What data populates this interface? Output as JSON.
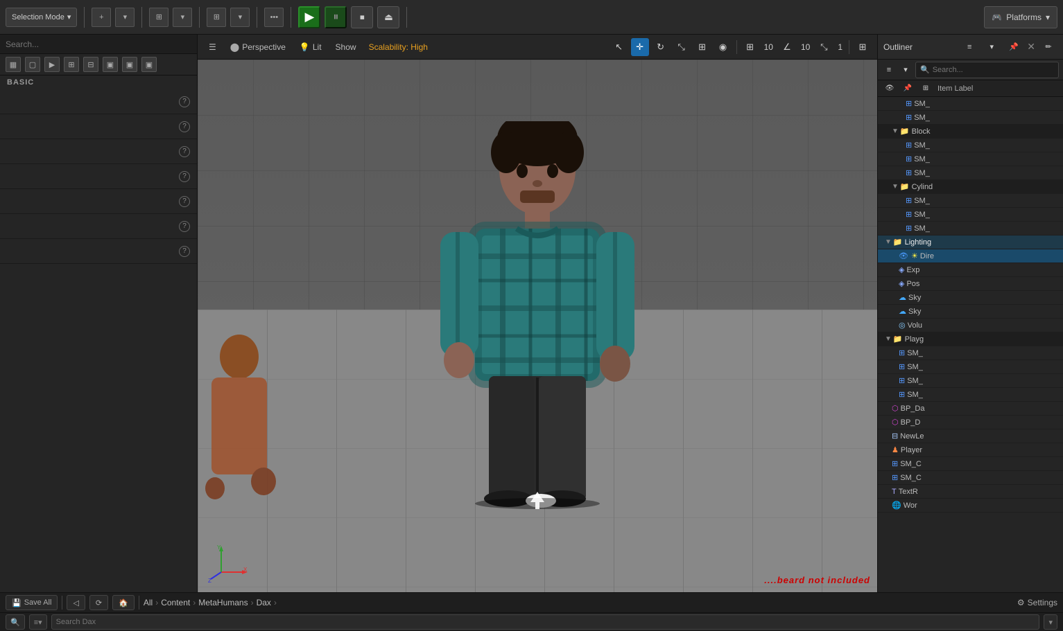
{
  "topToolbar": {
    "modeLabel": "Selection Mode",
    "playLabel": "▶",
    "pauseLabel": "⏸",
    "stopLabel": "⏹",
    "platformsLabel": "Platforms",
    "platformsIcon": "🎮"
  },
  "viewport": {
    "menuIcon": "☰",
    "perspectiveLabel": "Perspective",
    "litLabel": "Lit",
    "showLabel": "Show",
    "scalabilityLabel": "Scalability: High",
    "snapAngle1": "10",
    "snapAngle2": "10",
    "snapScale": "1"
  },
  "leftPanel": {
    "sectionLabel": "BASIC",
    "items": [
      {
        "label": "",
        "id": "item-1"
      },
      {
        "label": "",
        "id": "item-2"
      },
      {
        "label": "",
        "id": "item-3"
      },
      {
        "label": "",
        "id": "item-4"
      },
      {
        "label": "",
        "id": "item-5"
      },
      {
        "label": "",
        "id": "item-6"
      },
      {
        "label": "",
        "id": "item-7"
      }
    ]
  },
  "outliner": {
    "title": "Outliner",
    "searchPlaceholder": "Search...",
    "columnLabel": "Item Label",
    "items": [
      {
        "label": "SM_",
        "indent": 40,
        "type": "mesh",
        "id": "sm1"
      },
      {
        "label": "SM_",
        "indent": 40,
        "type": "mesh",
        "id": "sm2"
      },
      {
        "label": "Block",
        "indent": 20,
        "type": "folder",
        "expanded": true,
        "id": "block-folder"
      },
      {
        "label": "SM_",
        "indent": 40,
        "type": "mesh",
        "id": "sm3"
      },
      {
        "label": "SM_",
        "indent": 40,
        "type": "mesh",
        "id": "sm4"
      },
      {
        "label": "SM_",
        "indent": 40,
        "type": "mesh",
        "id": "sm5"
      },
      {
        "label": "Cylind",
        "indent": 20,
        "type": "folder",
        "expanded": true,
        "id": "cyl-folder"
      },
      {
        "label": "SM_",
        "indent": 40,
        "type": "mesh",
        "id": "sm6"
      },
      {
        "label": "SM_",
        "indent": 40,
        "type": "mesh",
        "id": "sm7"
      },
      {
        "label": "SM_",
        "indent": 40,
        "type": "mesh",
        "id": "sm8"
      },
      {
        "label": "Lighting",
        "indent": 10,
        "type": "folder",
        "expanded": true,
        "id": "lighting-folder",
        "highlighted": true
      },
      {
        "label": "Dire",
        "indent": 30,
        "type": "directional",
        "id": "dire",
        "selected": true
      },
      {
        "label": "Exp",
        "indent": 30,
        "type": "exp",
        "id": "exp"
      },
      {
        "label": "Pos",
        "indent": 30,
        "type": "pos",
        "id": "pos"
      },
      {
        "label": "Sky",
        "indent": 30,
        "type": "sky",
        "id": "sky1"
      },
      {
        "label": "Sky",
        "indent": 30,
        "type": "sky",
        "id": "sky2"
      },
      {
        "label": "Volu",
        "indent": 30,
        "type": "volume",
        "id": "volu"
      },
      {
        "label": "Playg",
        "indent": 10,
        "type": "folder",
        "expanded": true,
        "id": "playg-folder"
      },
      {
        "label": "SM_",
        "indent": 30,
        "type": "mesh",
        "id": "sm9"
      },
      {
        "label": "SM_",
        "indent": 30,
        "type": "mesh",
        "id": "sm10"
      },
      {
        "label": "SM_",
        "indent": 30,
        "type": "mesh",
        "id": "sm11"
      },
      {
        "label": "SM_",
        "indent": 30,
        "type": "mesh",
        "id": "sm12"
      },
      {
        "label": "BP_Da",
        "indent": 20,
        "type": "blueprint",
        "id": "bpda"
      },
      {
        "label": "BP_D",
        "indent": 20,
        "type": "blueprint",
        "id": "bpd"
      },
      {
        "label": "NewLe",
        "indent": 20,
        "type": "level",
        "id": "newle"
      },
      {
        "label": "Player",
        "indent": 20,
        "type": "player",
        "id": "player"
      },
      {
        "label": "SM_C",
        "indent": 20,
        "type": "mesh",
        "id": "smc"
      },
      {
        "label": "SM_C",
        "indent": 20,
        "type": "mesh",
        "id": "smc2"
      },
      {
        "label": "TextR",
        "indent": 20,
        "type": "text",
        "id": "textr"
      },
      {
        "label": "Wor",
        "indent": 20,
        "type": "world",
        "id": "wor"
      }
    ]
  },
  "bottomBar": {
    "saveAllLabel": "Save All",
    "allLabel": "All",
    "contentLabel": "Content",
    "metahumansLabel": "MetaHumans",
    "daxLabel": "Dax",
    "settingsLabel": "Settings",
    "searchPlaceholder": "Search Dax",
    "watermark": "....beard not included"
  }
}
